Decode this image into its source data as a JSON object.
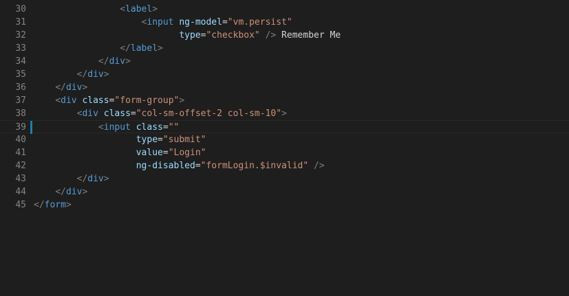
{
  "editor": {
    "lines": [
      {
        "num": "30",
        "tokens": [
          {
            "c": "p",
            "v": "                "
          },
          {
            "c": "p",
            "v": "<"
          },
          {
            "c": "t",
            "v": "label"
          },
          {
            "c": "p",
            "v": ">"
          }
        ]
      },
      {
        "num": "31",
        "tokens": [
          {
            "c": "p",
            "v": "                    "
          },
          {
            "c": "p",
            "v": "<"
          },
          {
            "c": "t",
            "v": "input"
          },
          {
            "c": "tx",
            "v": " "
          },
          {
            "c": "a",
            "v": "ng-model"
          },
          {
            "c": "tx",
            "v": "="
          },
          {
            "c": "s",
            "v": "\"vm.persist\""
          }
        ]
      },
      {
        "num": "32",
        "tokens": [
          {
            "c": "p",
            "v": "                           "
          },
          {
            "c": "a",
            "v": "type"
          },
          {
            "c": "tx",
            "v": "="
          },
          {
            "c": "s",
            "v": "\"checkbox\""
          },
          {
            "c": "tx",
            "v": " "
          },
          {
            "c": "p",
            "v": "/>"
          },
          {
            "c": "tx",
            "v": " Remember Me"
          }
        ]
      },
      {
        "num": "33",
        "tokens": [
          {
            "c": "p",
            "v": "                "
          },
          {
            "c": "p",
            "v": "</"
          },
          {
            "c": "t",
            "v": "label"
          },
          {
            "c": "p",
            "v": ">"
          }
        ]
      },
      {
        "num": "34",
        "tokens": [
          {
            "c": "p",
            "v": "            "
          },
          {
            "c": "p",
            "v": "</"
          },
          {
            "c": "t",
            "v": "div"
          },
          {
            "c": "p",
            "v": ">"
          }
        ]
      },
      {
        "num": "35",
        "tokens": [
          {
            "c": "p",
            "v": "        "
          },
          {
            "c": "p",
            "v": "</"
          },
          {
            "c": "t",
            "v": "div"
          },
          {
            "c": "p",
            "v": ">"
          }
        ]
      },
      {
        "num": "36",
        "tokens": [
          {
            "c": "p",
            "v": "    "
          },
          {
            "c": "p",
            "v": "</"
          },
          {
            "c": "t",
            "v": "div"
          },
          {
            "c": "p",
            "v": ">"
          }
        ]
      },
      {
        "num": "37",
        "tokens": [
          {
            "c": "p",
            "v": "    "
          },
          {
            "c": "p",
            "v": "<"
          },
          {
            "c": "t",
            "v": "div"
          },
          {
            "c": "tx",
            "v": " "
          },
          {
            "c": "a",
            "v": "class"
          },
          {
            "c": "tx",
            "v": "="
          },
          {
            "c": "s",
            "v": "\"form-group\""
          },
          {
            "c": "p",
            "v": ">"
          }
        ]
      },
      {
        "num": "38",
        "tokens": [
          {
            "c": "p",
            "v": "        "
          },
          {
            "c": "p",
            "v": "<"
          },
          {
            "c": "t",
            "v": "div"
          },
          {
            "c": "tx",
            "v": " "
          },
          {
            "c": "a",
            "v": "class"
          },
          {
            "c": "tx",
            "v": "="
          },
          {
            "c": "s",
            "v": "\"col-sm-offset-2 col-sm-10\""
          },
          {
            "c": "p",
            "v": ">"
          }
        ]
      },
      {
        "num": "39",
        "current": true,
        "tokens": [
          {
            "c": "p",
            "v": "            "
          },
          {
            "c": "p",
            "v": "<"
          },
          {
            "c": "t",
            "v": "input"
          },
          {
            "c": "tx",
            "v": " "
          },
          {
            "c": "a",
            "v": "class"
          },
          {
            "c": "tx",
            "v": "="
          },
          {
            "c": "s",
            "v": "\"\""
          }
        ]
      },
      {
        "num": "40",
        "tokens": [
          {
            "c": "p",
            "v": "                   "
          },
          {
            "c": "a",
            "v": "type"
          },
          {
            "c": "tx",
            "v": "="
          },
          {
            "c": "s",
            "v": "\"submit\""
          }
        ]
      },
      {
        "num": "41",
        "tokens": [
          {
            "c": "p",
            "v": "                   "
          },
          {
            "c": "a",
            "v": "value"
          },
          {
            "c": "tx",
            "v": "="
          },
          {
            "c": "s",
            "v": "\"Login\""
          }
        ]
      },
      {
        "num": "42",
        "tokens": [
          {
            "c": "p",
            "v": "                   "
          },
          {
            "c": "a",
            "v": "ng-disabled"
          },
          {
            "c": "tx",
            "v": "="
          },
          {
            "c": "s",
            "v": "\"formLogin.$invalid\""
          },
          {
            "c": "tx",
            "v": " "
          },
          {
            "c": "p",
            "v": "/>"
          }
        ]
      },
      {
        "num": "43",
        "tokens": [
          {
            "c": "p",
            "v": "        "
          },
          {
            "c": "p",
            "v": "</"
          },
          {
            "c": "t",
            "v": "div"
          },
          {
            "c": "p",
            "v": ">"
          }
        ]
      },
      {
        "num": "44",
        "tokens": [
          {
            "c": "p",
            "v": "    "
          },
          {
            "c": "p",
            "v": "</"
          },
          {
            "c": "t",
            "v": "div"
          },
          {
            "c": "p",
            "v": ">"
          }
        ]
      },
      {
        "num": "45",
        "tokens": [
          {
            "c": "p",
            "v": "</"
          },
          {
            "c": "t",
            "v": "form"
          },
          {
            "c": "p",
            "v": ">"
          }
        ]
      }
    ]
  }
}
